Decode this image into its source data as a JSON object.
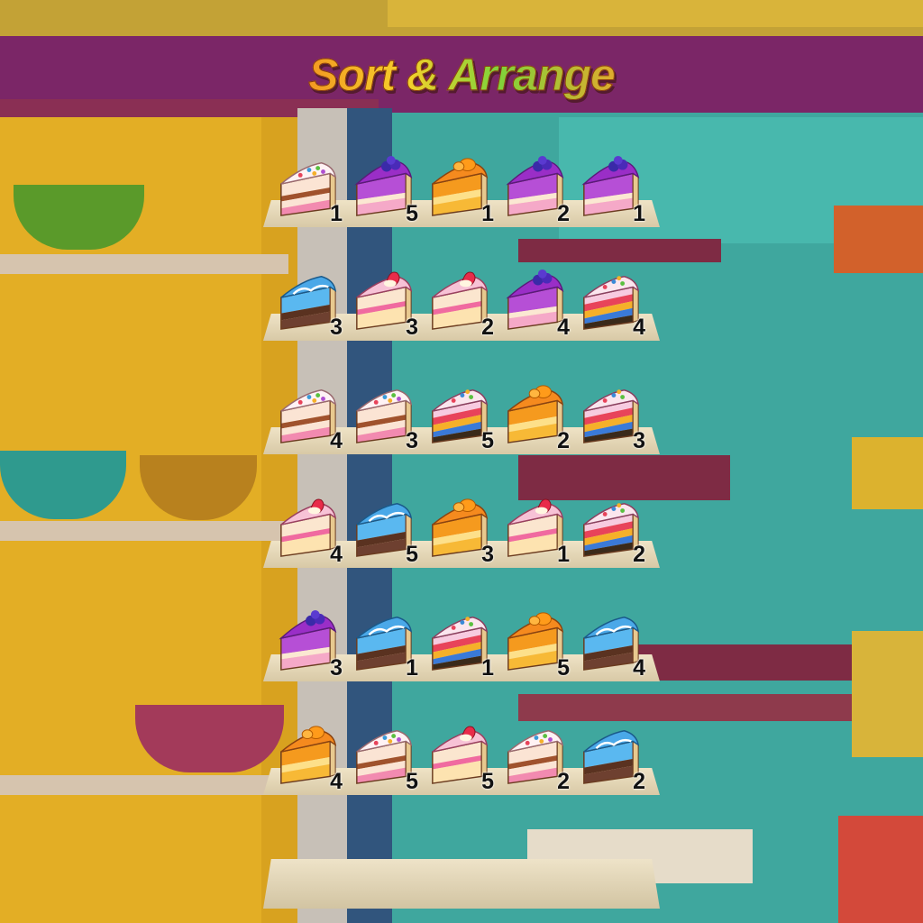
{
  "title": "Sort & Arrange",
  "shelves": [
    {
      "slots": [
        {
          "cake": "sprinkle-vanilla-cake",
          "count": "1"
        },
        {
          "cake": "blueberry-cake",
          "count": "5"
        },
        {
          "cake": "orange-cake",
          "count": "1"
        },
        {
          "cake": "blueberry-cake",
          "count": "2"
        },
        {
          "cake": "blueberry-cake",
          "count": "1"
        }
      ]
    },
    {
      "slots": [
        {
          "cake": "blue-chocolate-cake",
          "count": "3"
        },
        {
          "cake": "strawberry-cake",
          "count": "3"
        },
        {
          "cake": "strawberry-cake",
          "count": "2"
        },
        {
          "cake": "blueberry-cake",
          "count": "4"
        },
        {
          "cake": "rainbow-layer-cake",
          "count": "4"
        }
      ]
    },
    {
      "slots": [
        {
          "cake": "sprinkle-vanilla-cake",
          "count": "4"
        },
        {
          "cake": "sprinkle-vanilla-cake",
          "count": "3"
        },
        {
          "cake": "rainbow-layer-cake",
          "count": "5"
        },
        {
          "cake": "orange-cake",
          "count": "2"
        },
        {
          "cake": "rainbow-layer-cake",
          "count": "3"
        }
      ]
    },
    {
      "slots": [
        {
          "cake": "strawberry-cake",
          "count": "4"
        },
        {
          "cake": "blue-chocolate-cake",
          "count": "5"
        },
        {
          "cake": "orange-cake",
          "count": "3"
        },
        {
          "cake": "strawberry-cake",
          "count": "1"
        },
        {
          "cake": "rainbow-layer-cake",
          "count": "2"
        }
      ]
    },
    {
      "slots": [
        {
          "cake": "blueberry-cake",
          "count": "3"
        },
        {
          "cake": "blue-chocolate-cake",
          "count": "1"
        },
        {
          "cake": "rainbow-layer-cake",
          "count": "1"
        },
        {
          "cake": "orange-cake",
          "count": "5"
        },
        {
          "cake": "blue-chocolate-cake",
          "count": "4"
        }
      ]
    },
    {
      "slots": [
        {
          "cake": "orange-cake",
          "count": "4"
        },
        {
          "cake": "sprinkle-vanilla-cake",
          "count": "5"
        },
        {
          "cake": "strawberry-cake",
          "count": "5"
        },
        {
          "cake": "sprinkle-vanilla-cake",
          "count": "2"
        },
        {
          "cake": "blue-chocolate-cake",
          "count": "2"
        }
      ]
    }
  ],
  "colors": {
    "title_gradient": [
      "#f28a1f",
      "#f5d12b",
      "#7fd33a"
    ],
    "shelf": "#e6d8b8"
  }
}
